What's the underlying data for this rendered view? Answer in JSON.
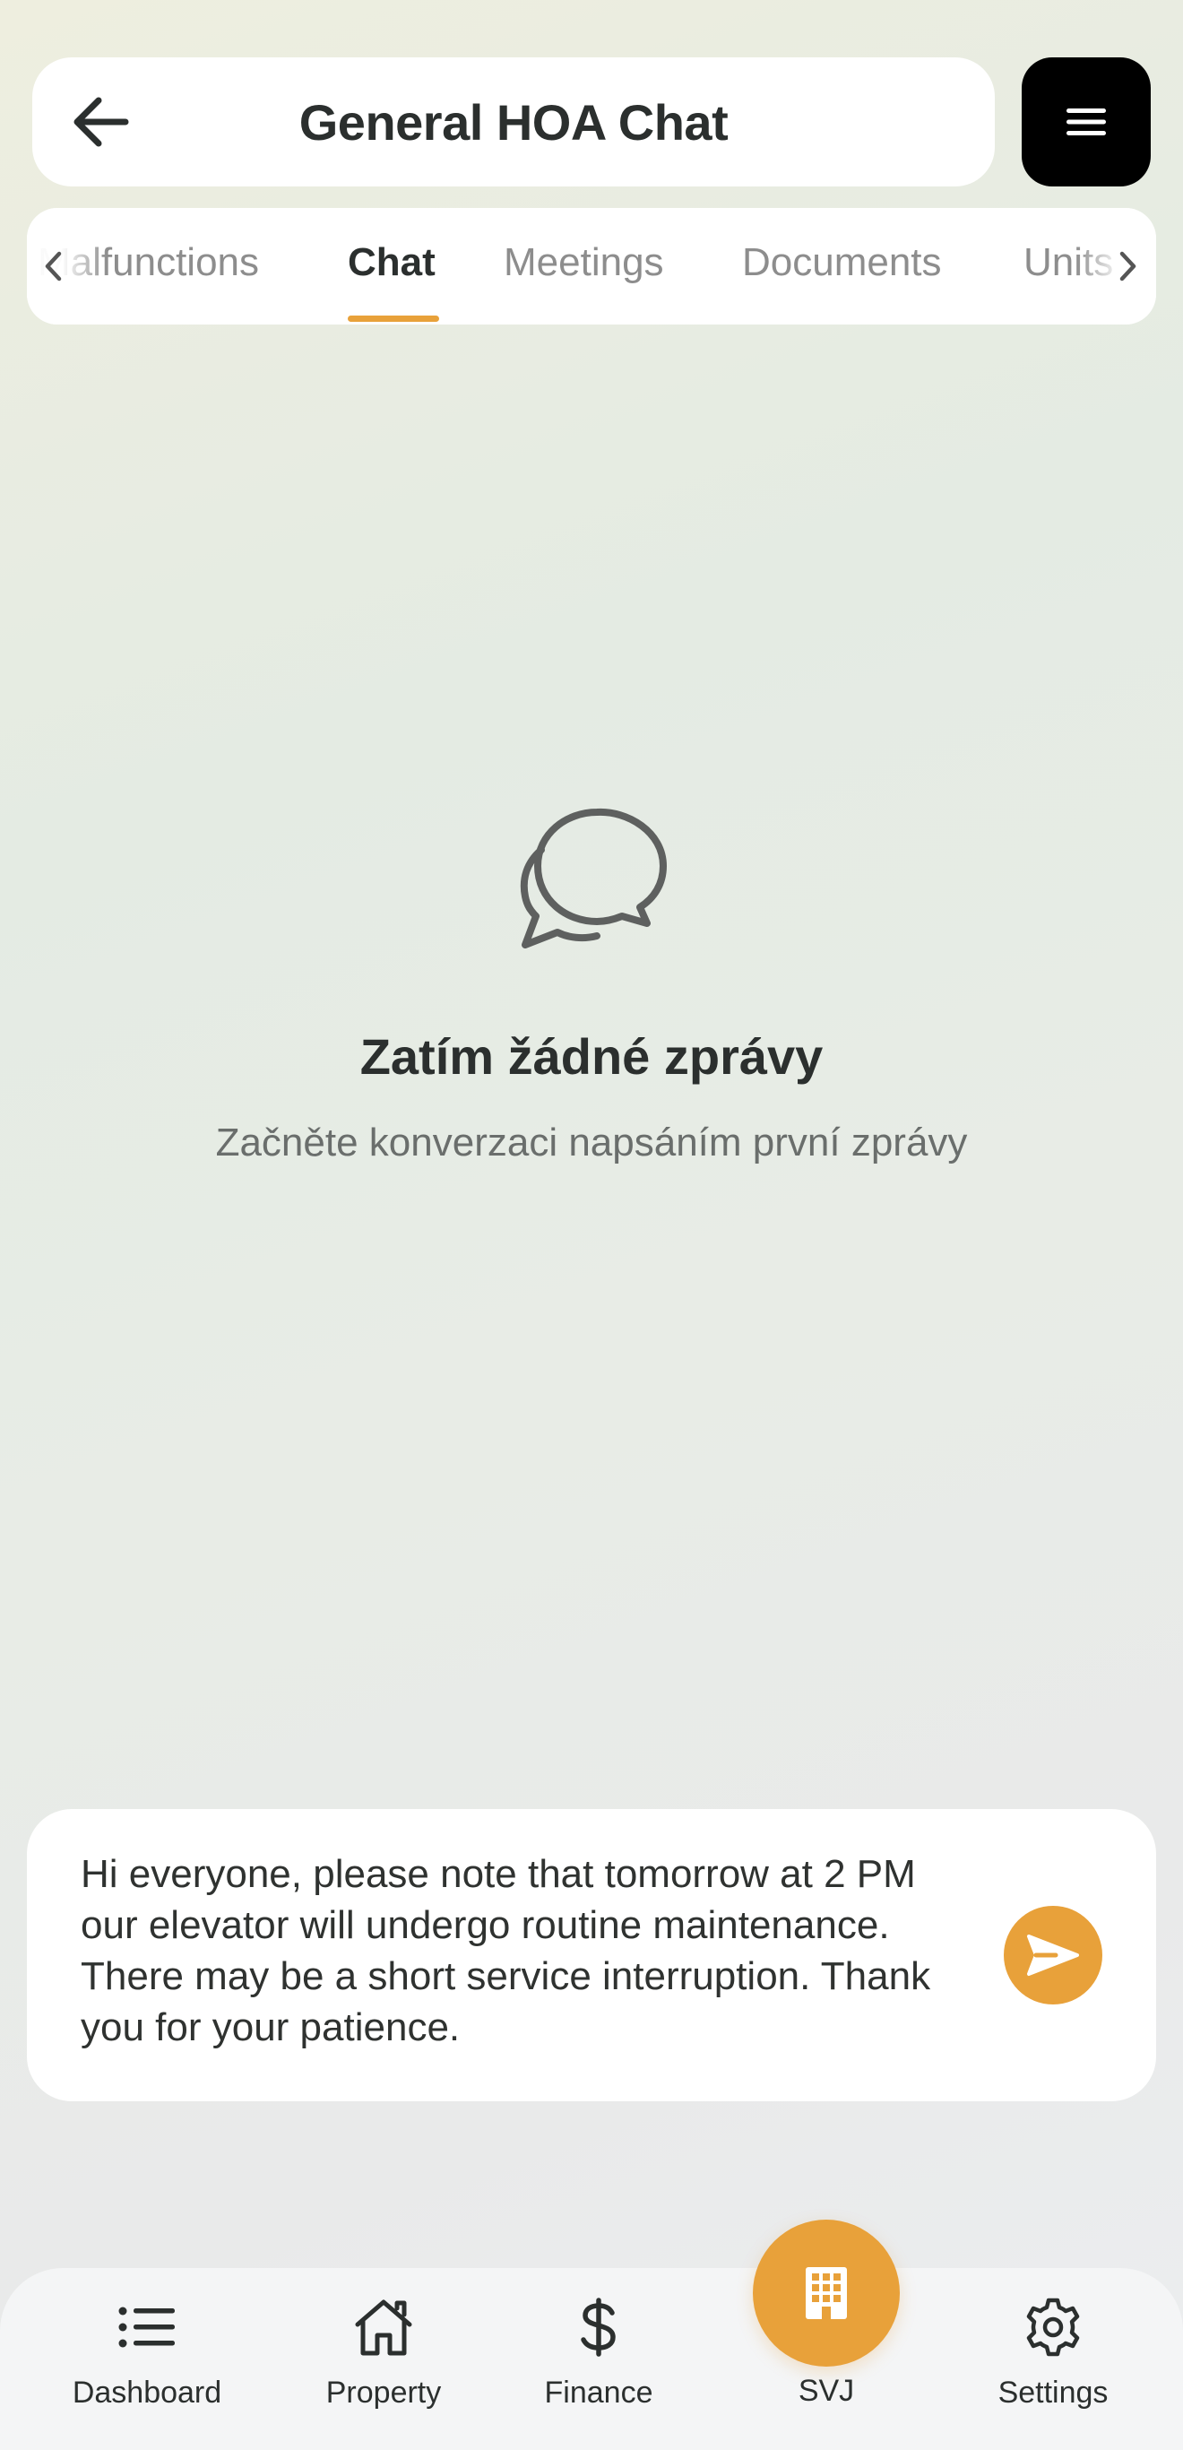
{
  "header": {
    "title": "General HOA Chat",
    "back_icon": "arrow-left-icon",
    "menu_icon": "hamburger-menu-icon"
  },
  "tabs": {
    "items": [
      {
        "label": "Malfunctions",
        "active": false
      },
      {
        "label": "Chat",
        "active": true
      },
      {
        "label": "Meetings",
        "active": false
      },
      {
        "label": "Documents",
        "active": false
      },
      {
        "label": "Units",
        "active": false
      }
    ],
    "accent_color": "#e8a13a"
  },
  "empty_state": {
    "icon": "chat-bubbles-icon",
    "title": "Zatím žádné zprávy",
    "subtitle": "Začněte konverzaci napsáním první zprávy"
  },
  "composer": {
    "value": "Hi everyone, please note that tomorrow at 2 PM our elevator will undergo routine maintenance. There may be a short service interruption. Thank you for your patience.",
    "send_icon": "send-icon"
  },
  "bottom_nav": {
    "items": [
      {
        "label": "Dashboard",
        "icon": "list-icon"
      },
      {
        "label": "Property",
        "icon": "home-icon"
      },
      {
        "label": "Finance",
        "icon": "dollar-icon"
      },
      {
        "label": "SVJ",
        "icon": "building-icon"
      },
      {
        "label": "Settings",
        "icon": "gear-icon"
      }
    ]
  }
}
